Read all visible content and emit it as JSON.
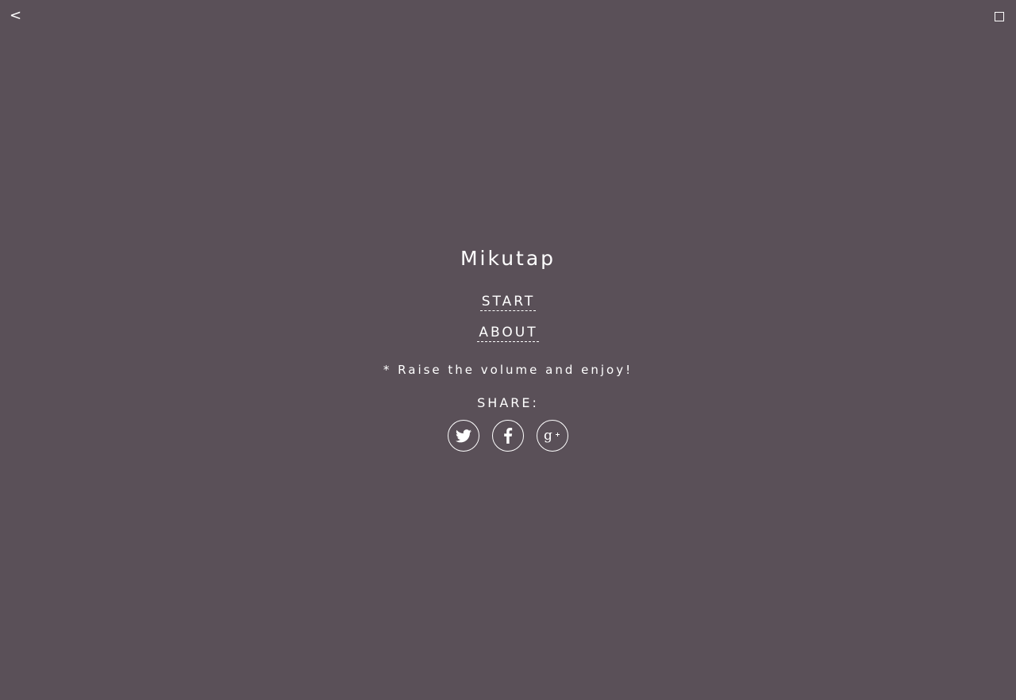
{
  "nav": {
    "back_label": "<"
  },
  "app": {
    "title": "Mikutap"
  },
  "menu": {
    "start_label": "START",
    "about_label": "ABOUT"
  },
  "note": "* Raise the volume and enjoy!",
  "share": {
    "label": "SHARE:",
    "buttons": [
      {
        "icon": "twitter-icon"
      },
      {
        "icon": "facebook-icon"
      },
      {
        "icon": "google-plus-icon"
      }
    ]
  },
  "colors": {
    "background": "#5a5058",
    "foreground": "#ffffff"
  }
}
